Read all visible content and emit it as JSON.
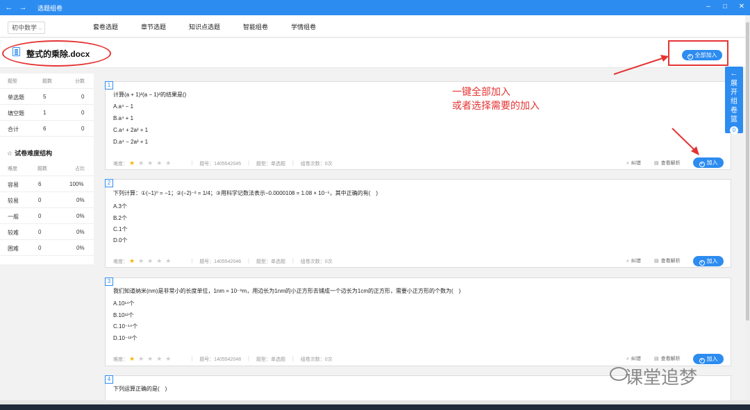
{
  "window": {
    "back": "←",
    "forward": "→",
    "title": "选题组卷",
    "min": "–",
    "max": "□",
    "close": "✕"
  },
  "nav": {
    "subject": "初中数学",
    "tabs": [
      "套卷选题",
      "章节选题",
      "知识点选题",
      "智能组卷",
      "学情组卷"
    ]
  },
  "doc": {
    "title": "整式的乘除.docx",
    "add_all": "全部加入"
  },
  "stats": {
    "headers": [
      "题型",
      "题数",
      "分数"
    ],
    "rows": [
      {
        "type": "单选题",
        "count": "5",
        "score": "0"
      },
      {
        "type": "填空题",
        "count": "1",
        "score": "0"
      },
      {
        "type": "合计",
        "count": "6",
        "score": "0"
      }
    ]
  },
  "difficulty": {
    "title": "试卷难度结构",
    "headers": [
      "难度",
      "题数",
      "占比"
    ],
    "rows": [
      {
        "level": "容易",
        "count": "6",
        "pct": "100%"
      },
      {
        "level": "较易",
        "count": "0",
        "pct": "0%"
      },
      {
        "level": "一般",
        "count": "0",
        "pct": "0%"
      },
      {
        "level": "较难",
        "count": "0",
        "pct": "0%"
      },
      {
        "level": "困难",
        "count": "0",
        "pct": "0%"
      }
    ]
  },
  "questions": [
    {
      "num": "1",
      "stem": "计算(a + 1)²(a − 1)²的结果是()",
      "options": [
        "A.a⁴ − 1",
        "B.a⁴ + 1",
        "C.a⁴ + 2a² + 1",
        "D.a⁴ − 2a² + 1"
      ],
      "difficulty_label": "难度：",
      "question_id": "题号：1405542045",
      "question_type": "题型：单选题",
      "group_count": "组卷次数：0次"
    },
    {
      "num": "2",
      "stem": "下列计算：①(−1)⁰ = −1；②(−2)⁻² = 1/4；③用科学记数法表示−0.0000108 = 1.08 × 10⁻⁵，其中正确的有(　)",
      "options": [
        "A.3个",
        "B.2个",
        "C.1个",
        "D.0个"
      ],
      "difficulty_label": "难度：",
      "question_id": "题号：1405542046",
      "question_type": "题型：单选题",
      "group_count": "组卷次数：0次"
    },
    {
      "num": "3",
      "stem": "我们知道纳米(nm)是非常小的长度单位，1nm = 10⁻⁹m，用边长为1nm的小正方形去铺成一个边长为1cm的正方形，需要小正方形的个数为(　)",
      "options": [
        "A.10¹⁴个",
        "B.10¹²个",
        "C.10⁻¹⁴个",
        "D.10⁻¹²个"
      ],
      "difficulty_label": "难度：",
      "question_id": "题号：1405542048",
      "question_type": "题型：单选题",
      "group_count": "组卷次数：0次"
    },
    {
      "num": "4",
      "stem": "下列运算正确的是(　)"
    }
  ],
  "actions": {
    "report": "纠错",
    "analysis": "查看解析",
    "add": "加入"
  },
  "annotation": {
    "line1": "一键全部加入",
    "line2": "或者选择需要的加入"
  },
  "basket": {
    "arrow": "←",
    "label": "展开组卷篮",
    "count": "0"
  },
  "watermark": "课堂追梦",
  "colors": {
    "accent": "#2d8cf0",
    "annotation": "#e53333",
    "star": "#f7b500"
  }
}
